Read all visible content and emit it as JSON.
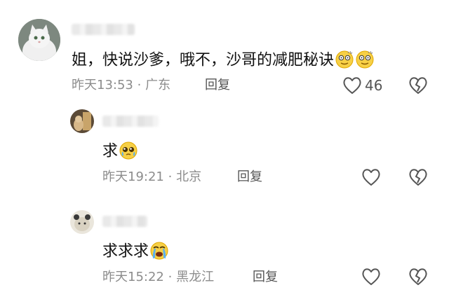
{
  "comments": [
    {
      "text": "姐，快说沙爹，哦不，沙哥的减肥秘诀",
      "emojis": [
        "dizzy-face-emoji",
        "dizzy-face-emoji"
      ],
      "time": "昨天13:53",
      "separator": "·",
      "location": "广东",
      "reply_label": "回复",
      "like_count": "46"
    },
    {
      "text": "求",
      "emojis": [
        "pleading-face-emoji"
      ],
      "time": "昨天19:21",
      "separator": "·",
      "location": "北京",
      "reply_label": "回复"
    },
    {
      "text": "求求求",
      "emojis": [
        "loudly-crying-face-emoji"
      ],
      "time": "昨天15:22",
      "separator": "·",
      "location": "黑龙江",
      "reply_label": "回复"
    }
  ],
  "colors": {
    "meta_text": "#8c8c8c",
    "icon_stroke": "#555555",
    "emoji_yellow": "#f7d046"
  },
  "icons": [
    "heart-outline-icon",
    "broken-heart-icon"
  ]
}
